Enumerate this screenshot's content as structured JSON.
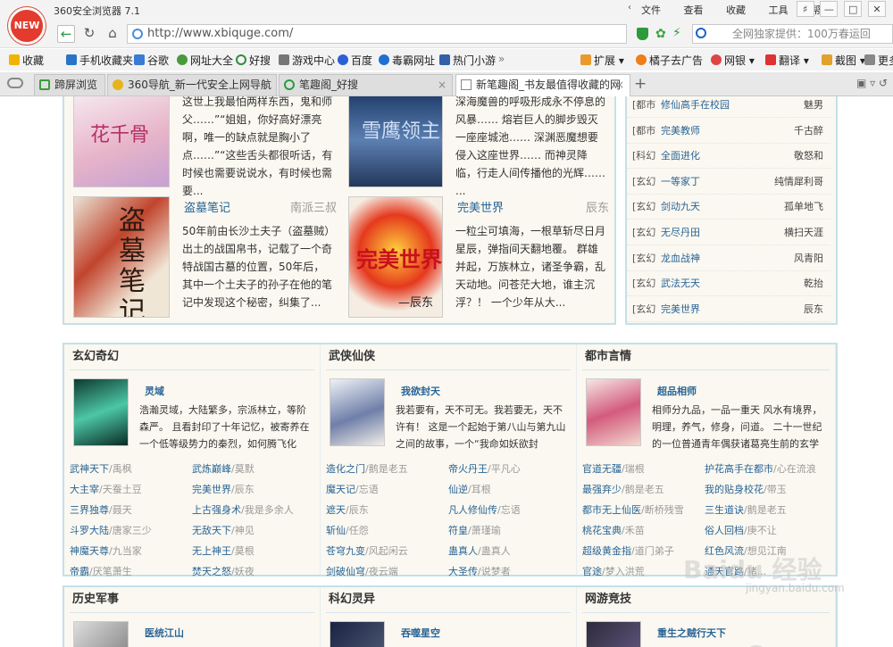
{
  "titlebar": {
    "logo": "NEW",
    "app_title": "360安全浏览器 7.1",
    "menu": [
      "文件",
      "查看",
      "收藏",
      "工具",
      "帮助"
    ]
  },
  "addressbar": {
    "url": "http://www.xbiquge.com/",
    "search_placeholder": "全网独家提供：100万春运回"
  },
  "bookmarks": [
    "收藏",
    "手机收藏夹",
    "谷歌",
    "网址大全",
    "好搜",
    "游戏中心",
    "百度",
    "毒霸网址",
    "热门小游",
    "扩展",
    "橘子去广告",
    "网银",
    "翻译",
    "截图",
    "更多"
  ],
  "tabs": [
    {
      "label": "蹄屏浏览",
      "active": false
    },
    {
      "label": "360导航_新一代安全上网导航",
      "active": false
    },
    {
      "label": "笔趣阁_好搜",
      "active": false
    },
    {
      "label": "新笔趣阁_书友最值得收藏的网",
      "active": true
    }
  ],
  "top_books": [
    {
      "title": "",
      "author": "",
      "desc": "这世上我最怕两样东西，鬼和师父……”“姐姐，你好高好漂亮啊，唯一的缺点就是胸小了点……”“这些舌头都很听话，有时候也需要说说水，有时候也需要..."
    },
    {
      "title": "",
      "author": "",
      "desc": "深海魔兽的呼吸形成永不停息的风暴…… 熔岩巨人的脚步毁灭一座座城池…… 深渊恶魔想要侵入这座世界…… 而神灵降临，行走人间传播他的光辉…… ..."
    },
    {
      "title": "盗墓笔记",
      "author": "南派三叔",
      "desc": "50年前由长沙土夫子（盗墓贼）出土的战国帛书，记载了一个奇特战国古墓的位置，50年后，其中一个土夫子的孙子在他的笔记中发现这个秘密，纠集了..."
    },
    {
      "title": "完美世界",
      "author": "辰东",
      "desc": "一粒尘可填海，一根草斩尽日月星辰，弹指间天翻地覆。 群雄并起，万族林立，诸圣争霸，乱天动地。问苍茫大地，谁主沉浮？！ 一个少年从大..."
    }
  ],
  "ranking": [
    {
      "cat": "[都市",
      "title": "修仙高手在校园",
      "author": "魅男"
    },
    {
      "cat": "[都市",
      "title": "完美教师",
      "author": "千古醉"
    },
    {
      "cat": "[科幻",
      "title": "全面进化",
      "author": "敬怒和"
    },
    {
      "cat": "[玄幻",
      "title": "一等家丁",
      "author": "纯情犀利哥"
    },
    {
      "cat": "[玄幻",
      "title": "剑动九天",
      "author": "孤单地飞"
    },
    {
      "cat": "[玄幻",
      "title": "无尽丹田",
      "author": "横扫天涯"
    },
    {
      "cat": "[玄幻",
      "title": "龙血战神",
      "author": "风青阳"
    },
    {
      "cat": "[玄幻",
      "title": "武法无天",
      "author": "乾抬"
    },
    {
      "cat": "[玄幻",
      "title": "完美世界",
      "author": "辰东"
    }
  ],
  "sections": [
    {
      "name": "玄幻奇幻",
      "feature": {
        "title": "灵域",
        "desc": "浩瀚灵域，大陆繁多，宗派林立，等阶森严。 且看封印了十年记忆，被寄养在一个低等级势力的秦烈，如何腾飞化龙，执"
      },
      "list": [
        [
          "武神天下",
          "/禹枫",
          "武炼巅峰",
          "/莫默"
        ],
        [
          "大主宰",
          "/天蚕土豆",
          "完美世界",
          "/辰东"
        ],
        [
          "三界独尊",
          "/聂天",
          "上古强身术",
          "/我是多余人"
        ],
        [
          "斗罗大陆",
          "/唐家三少",
          "无敌天下",
          "/神见"
        ],
        [
          "神魔天尊",
          "/九当家",
          "无上神王",
          "/莫根"
        ],
        [
          "帝霸",
          "/厌笔萧生",
          "焚天之怒",
          "/妖夜"
        ]
      ]
    },
    {
      "name": "武侠仙侠",
      "feature": {
        "title": "我欲封天",
        "desc": "我若要有，天不可无。我若要无，天不许有！ 这是一个起始于第八山与第九山之间的故事，一个“我命如妖欲封"
      },
      "list": [
        [
          "造化之门",
          "/鹅是老五",
          "帝火丹王",
          "/平凡心"
        ],
        [
          "魔天记",
          "/忘语",
          "仙逆",
          "/耳根"
        ],
        [
          "遮天",
          "/辰东",
          "凡人修仙传",
          "/忘语"
        ],
        [
          "斩仙",
          "/任怨",
          "符皇",
          "/萧瑾瑜"
        ],
        [
          "苍穹九变",
          "/风起闲云",
          "蛊真人",
          "/蛊真人"
        ],
        [
          "剑破仙穹",
          "/夜云端",
          "大圣传",
          "/说梦者"
        ]
      ]
    },
    {
      "name": "都市言情",
      "feature": {
        "title": "超品相师",
        "desc": "相师分九品，一品一重天 风水有境界，明理，养气，修身，问道。 二十一世纪的一位普通青年偶获诸葛亮生前的玄学传"
      },
      "list": [
        [
          "官道无疆",
          "/瑞根",
          "护花高手在都市",
          "/心在流浪"
        ],
        [
          "最强弃少",
          "/鹅是老五",
          "我的贴身校花",
          "/带玉"
        ],
        [
          "都市无上仙医",
          "/断桥残雪",
          "三生道诀",
          "/鹅是老五"
        ],
        [
          "桃花宝典",
          "/禾苗",
          "俗人回档",
          "/庚不让"
        ],
        [
          "超级黄金指",
          "/道门弟子",
          "红色风流",
          "/想见江南"
        ],
        [
          "官途",
          "/梦入洪荒",
          "通天官路",
          "/猪..."
        ]
      ]
    }
  ],
  "bottom_sections": [
    {
      "name": "历史军事",
      "feature_title": "医统江山"
    },
    {
      "name": "科幻灵异",
      "feature_title": "吞噬星空"
    },
    {
      "name": "网游竞技",
      "feature_title": "重生之贼行天下"
    }
  ],
  "watermark": {
    "brand": "Baidu 经验",
    "url": "jingyan.baidu.com"
  }
}
